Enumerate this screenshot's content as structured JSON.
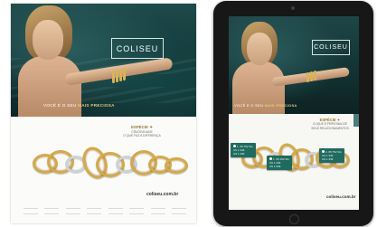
{
  "print_ad": {
    "brand": "COLISEU",
    "tagline_prefix": "VOCÊ É O SEU",
    "tagline_highlight": "MAIS PRECIOSA",
    "promo_title": "ESPÉCIE ✦",
    "promo_line1": "CRIATIVIDADE",
    "promo_line2": "O QUE FAZ A DIFERENÇA",
    "website": "coliseu.com.br"
  },
  "tablet": {
    "brand": "COLISEU",
    "tagline_prefix": "VOCÊ É O SEU",
    "tagline_highlight": "MAIS PRECIOSA",
    "promo_title": "ESPÉCIE ✦",
    "promo_line1": "CLIQUE E PERSONALIZE",
    "promo_line2": "SEUS RELACIONAMENTOS",
    "website": "coliseu.com.br",
    "price_tags": [
      {
        "line1": "1. 65.752 SG",
        "line2": "AS 1.349",
        "line3": "AS 1.349"
      },
      {
        "line1": "1. 65.152 SG",
        "line2": "AS 1.349",
        "line3": "AS 1.949"
      },
      {
        "line1": "2. 65.752 SG",
        "line2": "AS 1.349",
        "line3": "AS 1.349"
      }
    ]
  },
  "colors": {
    "photo_teal": "#1f4a4b",
    "gold": "#d4a94c",
    "tag_green": "#1f6b5f",
    "tablet_bezel": "#171717"
  }
}
